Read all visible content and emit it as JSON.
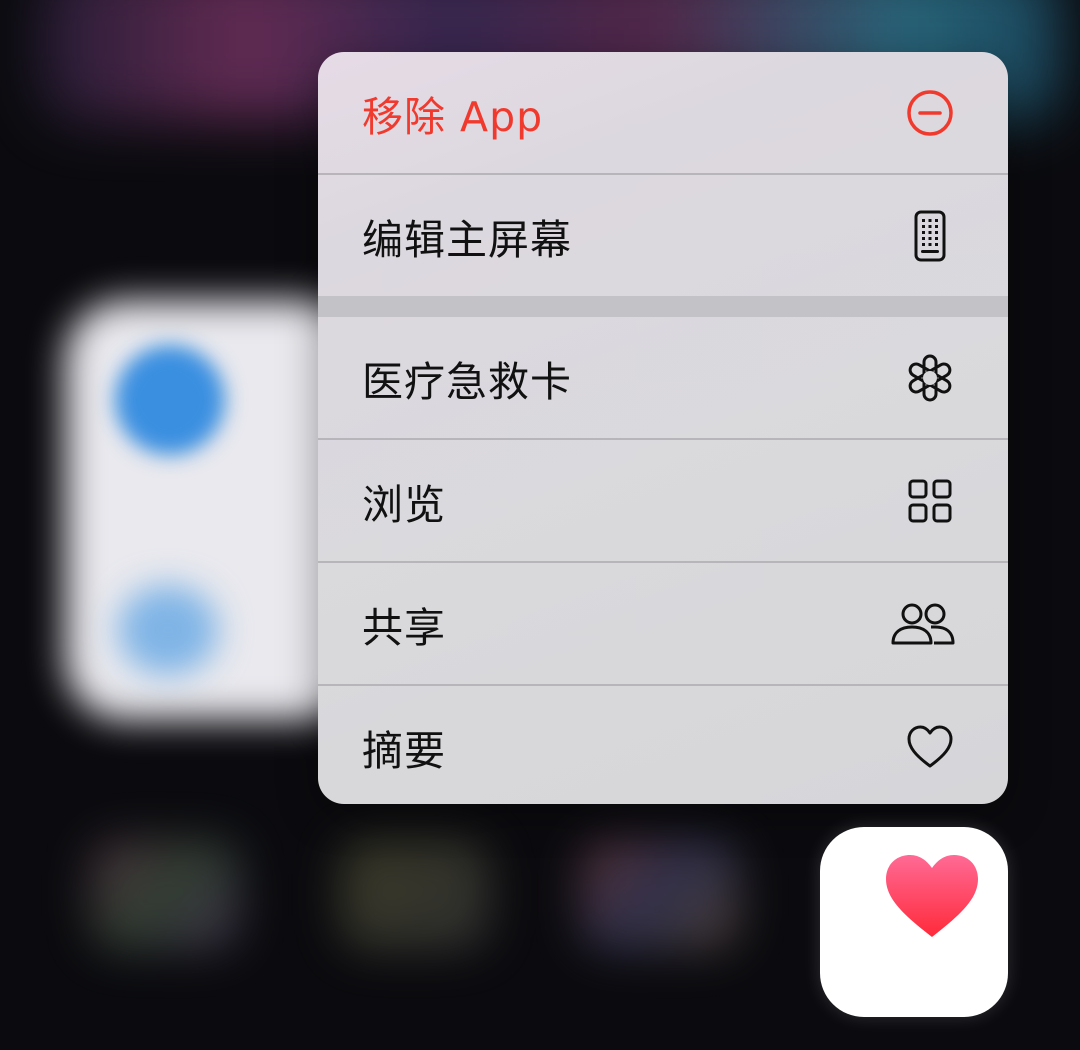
{
  "menu": {
    "items": [
      {
        "label": "移除 App",
        "icon": "minus-circle-icon",
        "destructive": true
      },
      {
        "label": "编辑主屏幕",
        "icon": "phone-grid-icon",
        "destructive": false
      },
      {
        "label": "医疗急救卡",
        "icon": "medical-asterisk-icon",
        "destructive": false
      },
      {
        "label": "浏览",
        "icon": "grid-squares-icon",
        "destructive": false
      },
      {
        "label": "共享",
        "icon": "people-icon",
        "destructive": false
      },
      {
        "label": "摘要",
        "icon": "heart-outline-icon",
        "destructive": false
      }
    ]
  },
  "app": {
    "icon": "health-heart-icon"
  },
  "colors": {
    "destructive": "#f13a2e",
    "text": "#111111",
    "menu_bg": "#d9d9dc",
    "health_heart_top": "#ff5f8f",
    "health_heart_bottom": "#ff2d3a"
  }
}
